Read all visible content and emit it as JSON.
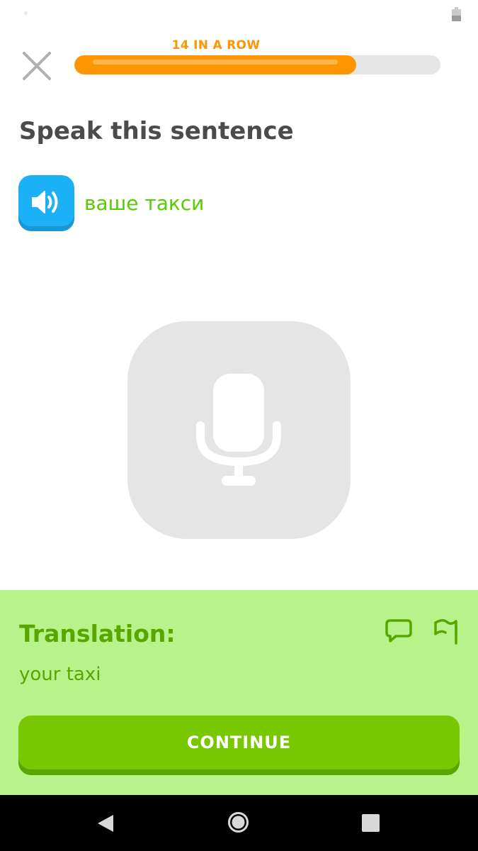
{
  "header": {
    "streak_label": "14 IN A ROW",
    "progress_fraction": 0.77,
    "close_icon": "close-icon"
  },
  "challenge": {
    "prompt": "Speak this sentence",
    "speaker_icon": "speaker-icon",
    "target_sentence": "ваше такси",
    "mic_icon": "microphone-icon"
  },
  "feedback": {
    "title": "Translation:",
    "text": "your taxi",
    "discuss_icon": "comment-icon",
    "report_icon": "flag-icon",
    "continue_label": "CONTINUE"
  },
  "colors": {
    "accent_orange": "#ff9600",
    "speaker_blue": "#1cb0f6",
    "correct_green": "#58cc02",
    "feedback_bg": "#b8f28b",
    "feedback_text": "#58a700",
    "continue_bg": "#78c800",
    "mic_bg": "#e5e5e5"
  },
  "nav_bar": {
    "icons": [
      "back-icon",
      "home-icon",
      "recents-icon"
    ]
  }
}
